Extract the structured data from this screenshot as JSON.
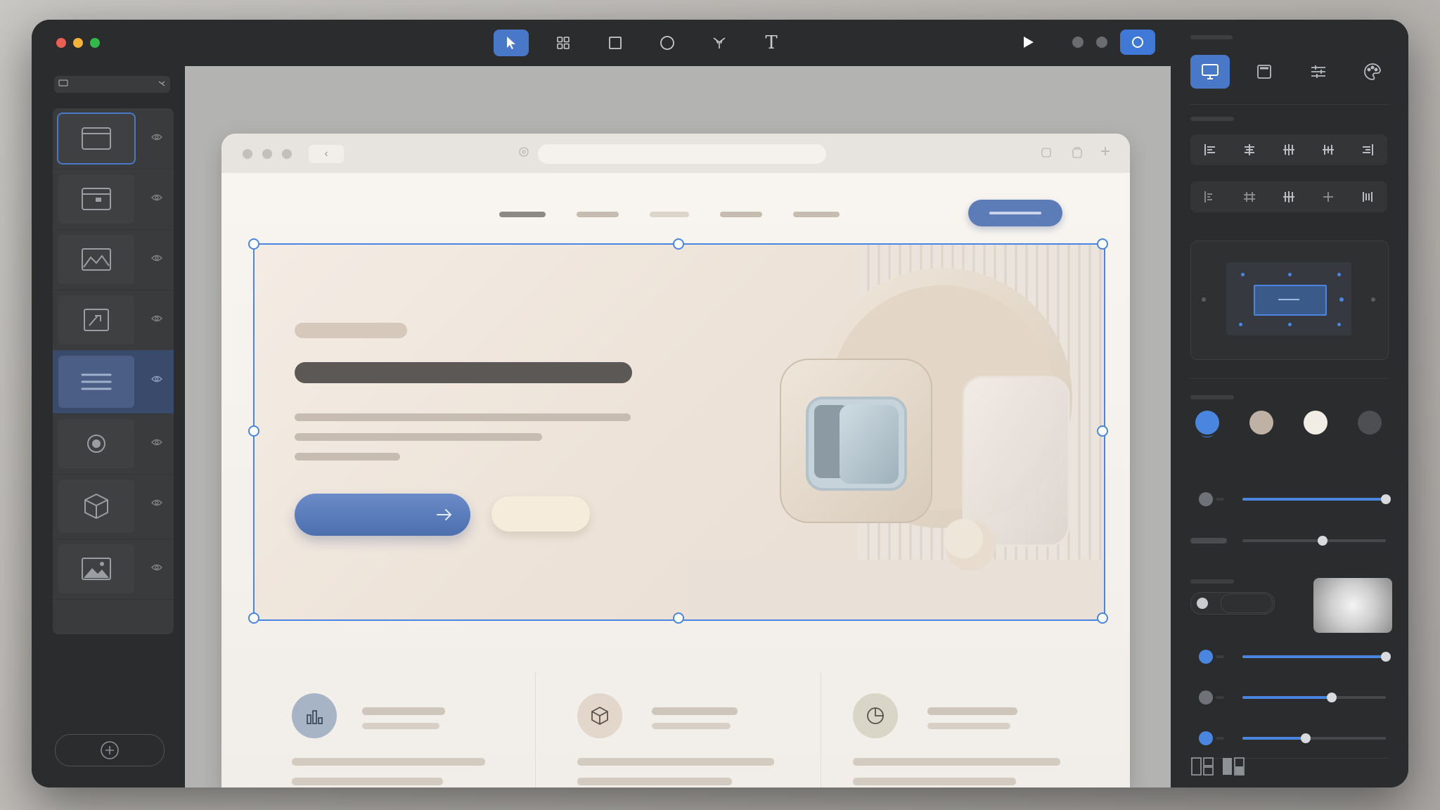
{
  "window": {
    "traffic_colors": [
      "#ec5f55",
      "#f2b338",
      "#2fba4a"
    ]
  },
  "toolbar": {
    "tools": [
      {
        "name": "select",
        "icon": "pointer-icon",
        "active": true
      },
      {
        "name": "frame",
        "icon": "grid-icon",
        "active": false
      },
      {
        "name": "rectangle",
        "icon": "square-icon",
        "active": false
      },
      {
        "name": "ellipse",
        "icon": "circle-icon",
        "active": false
      },
      {
        "name": "pen",
        "icon": "pen-icon",
        "active": false
      },
      {
        "name": "text",
        "icon": "text-icon",
        "active": false
      }
    ],
    "text_tool_glyph": "T",
    "play_icon": "play-icon",
    "record_icon": "record-icon"
  },
  "layers_panel": {
    "header_icon": "folder-icon",
    "items": [
      {
        "icon": "browser-window-icon",
        "selected": false,
        "outlined": true
      },
      {
        "icon": "window-icon",
        "selected": false,
        "outlined": false
      },
      {
        "icon": "image-mountain-icon",
        "selected": false,
        "outlined": false
      },
      {
        "icon": "frame-crop-icon",
        "selected": false,
        "outlined": false
      },
      {
        "icon": "text-lines-icon",
        "selected": true,
        "outlined": false
      },
      {
        "icon": "radio-target-icon",
        "selected": false,
        "outlined": false
      },
      {
        "icon": "cube-icon",
        "selected": false,
        "outlined": false
      },
      {
        "icon": "image-icon",
        "selected": false,
        "outlined": false
      }
    ],
    "add_icon": "plus-circle-icon"
  },
  "browser_preview": {
    "nav_icons": [
      "back-icon",
      "shield-icon",
      "copy-icon",
      "plus-icon"
    ],
    "back_glyph": "‹",
    "plus_glyph": "+",
    "features": [
      {
        "icon": "bar-chart-icon",
        "color": "#a6b4c6"
      },
      {
        "icon": "cube-icon",
        "color": "#e3d7cb"
      },
      {
        "icon": "pie-chart-icon",
        "color": "#d9d6c8"
      }
    ],
    "hero_primary_button_icon": "arrow-right-icon"
  },
  "right_panel": {
    "tabs": [
      {
        "icon": "monitor-icon",
        "active": true
      },
      {
        "icon": "page-icon",
        "active": false
      },
      {
        "icon": "sliders-icon",
        "active": false
      },
      {
        "icon": "palette-icon",
        "active": false
      }
    ],
    "swatches": [
      "#4a86e0",
      "#bfb2a4",
      "#f1ece4",
      "#4d4f52"
    ],
    "sliders": [
      {
        "value": 1.0,
        "knob_color": "#6f7276"
      },
      {
        "value": 0.5,
        "knob_color": "#5a5d60"
      },
      {
        "value": 1.0,
        "knob_color": "#4a86e0"
      },
      {
        "value": 0.6,
        "knob_color": "#6f7276"
      },
      {
        "value": 0.38,
        "knob_color": "#4a86e0"
      }
    ],
    "layout_icons": [
      "split-layout-icon",
      "split-layout-alt-icon"
    ]
  }
}
